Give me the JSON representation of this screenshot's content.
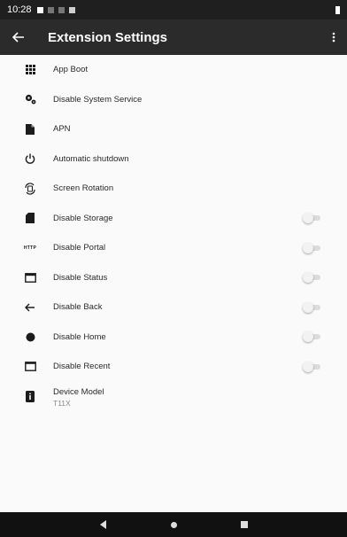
{
  "status_bar": {
    "time": "10:28"
  },
  "app_bar": {
    "back_icon": "arrow-left-icon",
    "title": "Extension Settings",
    "more_icon": "more-vert-icon"
  },
  "settings": [
    {
      "label": "App Boot",
      "icon": "apps-grid-icon"
    },
    {
      "label": "Disable System Service",
      "icon": "gears-icon"
    },
    {
      "label": "APN",
      "icon": "file-icon"
    },
    {
      "label": "Automatic shutdown",
      "icon": "power-icon"
    },
    {
      "label": "Screen Rotation",
      "icon": "rotation-icon"
    },
    {
      "label": "Disable Storage",
      "icon": "sd-card-icon",
      "toggle": false
    },
    {
      "label": "Disable Portal",
      "icon": "http-icon",
      "icon_text": "HTTP",
      "toggle": false
    },
    {
      "label": "Disable Status",
      "icon": "status-window-icon",
      "toggle": false
    },
    {
      "label": "Disable Back",
      "icon": "arrow-left-icon",
      "toggle": false
    },
    {
      "label": "Disable Home",
      "icon": "circle-icon",
      "toggle": false
    },
    {
      "label": "Disable Recent",
      "icon": "window-icon",
      "toggle": false
    },
    {
      "label": "Device Model",
      "icon": "device-info-icon",
      "value": "T11X"
    }
  ]
}
